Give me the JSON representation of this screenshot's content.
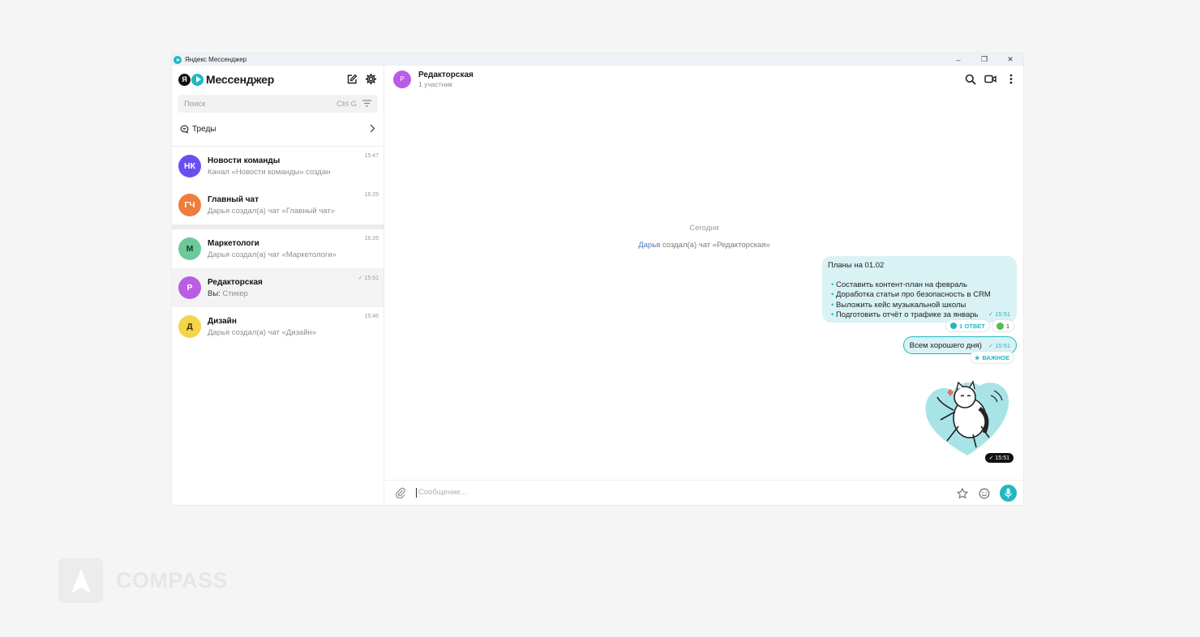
{
  "window": {
    "title": "Яндекс Мессенджер",
    "controls": [
      "–",
      "❐",
      "✕"
    ]
  },
  "sidebar": {
    "brand_logo_text": "Я",
    "brand": "Мессенджер",
    "search": {
      "placeholder": "Поиск",
      "shortcut": "Ctrl G"
    },
    "threads_label": "Треды",
    "chats": [
      {
        "initials": "НК",
        "name": "Новости команды",
        "preview": "Канал «Новости команды» создан",
        "time": "15:47",
        "color": "#6a4ff0"
      },
      {
        "initials": "ГЧ",
        "name": "Главный чат",
        "preview": "Дарья создал(а) чат «Главный чат»",
        "time": "16:25",
        "color": "#ef7d3c"
      },
      {
        "initials": "М",
        "name": "Маркетологи",
        "preview": "Дарья создал(а) чат «Маркетологи»",
        "time": "16:26",
        "color": "#6dc99a"
      },
      {
        "initials": "Р",
        "name": "Редакторская",
        "preview_prefix": "Вы:",
        "preview": "Стикер",
        "time": "✓ 15:51",
        "color": "#b95de5"
      },
      {
        "initials": "Д",
        "name": "Дизайн",
        "preview": "Дарья создал(а) чат «Дизайн»",
        "time": "15:46",
        "color": "#f5d44a"
      }
    ]
  },
  "chat": {
    "avatar": "Р",
    "name": "Редакторская",
    "subtitle": "1 участник",
    "day": "Сегодня",
    "system": {
      "user": "Дарья",
      "text": "создал(а) чат «Редакторская»"
    },
    "message1": {
      "title": "Планы на 01.02",
      "items": [
        "Составить контент-план на февраль",
        "Доработка статьи про безопасность в CRM",
        "Выложить кейс музыкальной школы",
        "Подготовить отчёт о трафике за январь"
      ],
      "time": "✓ 15:51",
      "replies": "1 ОТВЕТ",
      "reaction_count": "1"
    },
    "message2": {
      "text": "Всем хорошего дня)",
      "time": "✓ 15:51",
      "tag": "ВАЖНОЕ"
    },
    "sticker_time": "✓ 15:51",
    "composer_placeholder": "Сообщение..."
  },
  "watermark": "COMPASS",
  "colors": {
    "accent": "#1fb8c2",
    "bubble": "#d9f2f4"
  }
}
